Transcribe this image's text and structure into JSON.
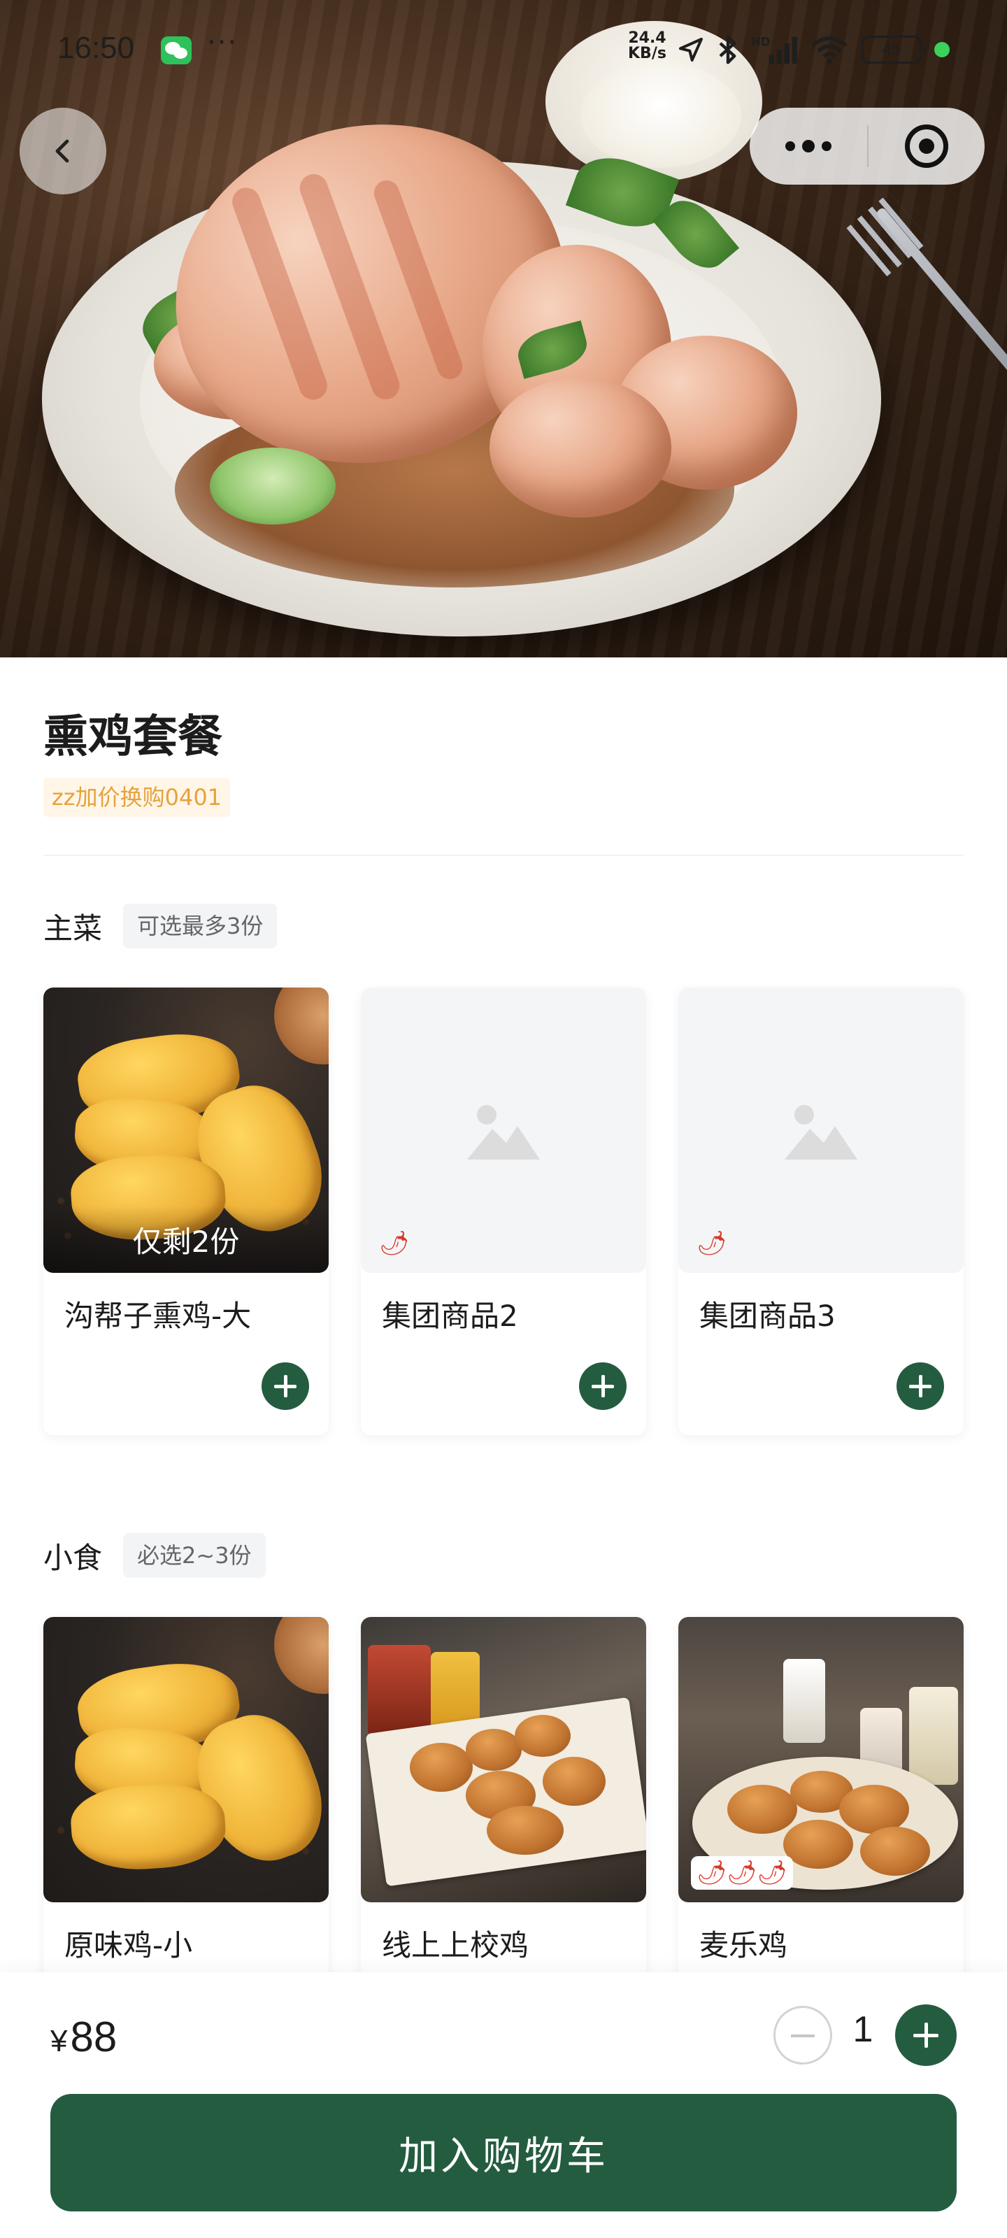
{
  "status_bar": {
    "time": "16:50",
    "net_speed_top": "24.4",
    "net_speed_bottom": "KB/s",
    "battery": "45",
    "icons": [
      "wechat-icon",
      "location-icon",
      "bluetooth-icon",
      "signal-hd-icon",
      "wifi-icon",
      "battery-icon"
    ]
  },
  "nav": {
    "back_icon": "chevron-left-icon",
    "more_icon": "more-dots-icon",
    "close_icon": "target-close-icon"
  },
  "product": {
    "title": "熏鸡套餐",
    "promo_tag": "zz加价换购0401"
  },
  "sections": [
    {
      "name": "主菜",
      "rule": "可选最多3份",
      "items": [
        {
          "name": "沟帮子熏鸡-大",
          "stock_note": "仅剩2份",
          "image": "nuggets",
          "spicy": 0
        },
        {
          "name": "集团商品2",
          "image": "placeholder",
          "spicy": 1
        },
        {
          "name": "集团商品3",
          "image": "placeholder",
          "spicy": 1
        }
      ]
    },
    {
      "name": "小食",
      "rule": "必选2~3份",
      "items": [
        {
          "name": "原味鸡-小",
          "image": "nuggets",
          "spicy": 0
        },
        {
          "name": "线上上校鸡",
          "image": "tray",
          "spicy": 0
        },
        {
          "name": "麦乐鸡",
          "image": "cafe",
          "spicy": 3
        }
      ]
    }
  ],
  "bottom_bar": {
    "currency": "¥",
    "price": "88",
    "quantity": "1",
    "add_to_cart": "加入购物车"
  },
  "colors": {
    "brand_green": "#245c3f",
    "promo_orange": "#e6a23c",
    "promo_bg": "#fff6e8",
    "spicy_red": "#d83a2e"
  }
}
